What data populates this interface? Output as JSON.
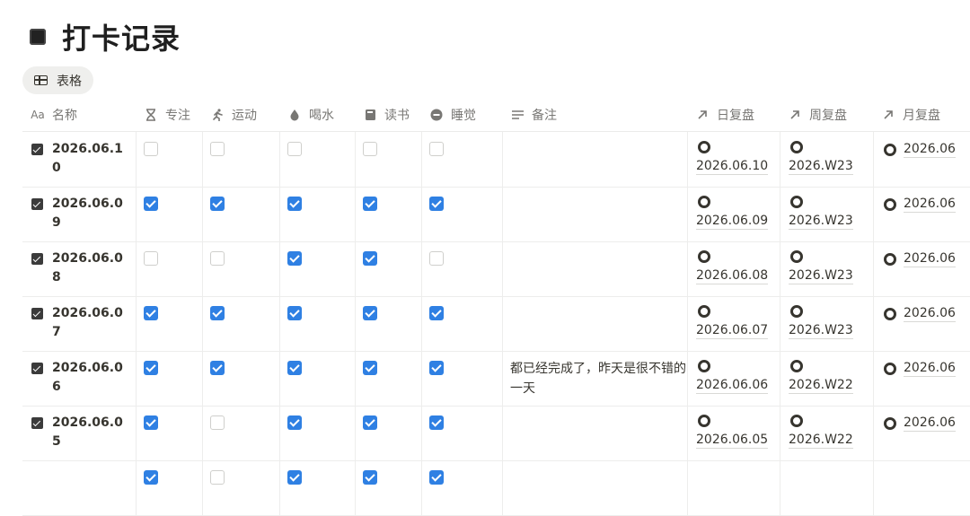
{
  "page": {
    "title": "打卡记录",
    "title_icon": "black-square-icon"
  },
  "view": {
    "label": "表格",
    "icon": "table-icon"
  },
  "columns": {
    "name": {
      "label": "名称",
      "icon": "Aa"
    },
    "focus": {
      "label": "专注",
      "icon": "hourglass-icon"
    },
    "exercise": {
      "label": "运动",
      "icon": "running-icon"
    },
    "water": {
      "label": "喝水",
      "icon": "water-drop-icon"
    },
    "reading": {
      "label": "读书",
      "icon": "book-icon"
    },
    "sleep": {
      "label": "睡觉",
      "icon": "minus-circle-icon"
    },
    "note": {
      "label": "备注",
      "icon": "text-lines-icon"
    },
    "day": {
      "label": "日复盘",
      "icon": "arrow-up-right-icon"
    },
    "week": {
      "label": "周复盘",
      "icon": "arrow-up-right-icon"
    },
    "month": {
      "label": "月复盘",
      "icon": "arrow-up-right-icon"
    }
  },
  "rows": [
    {
      "name": "2026.06.10",
      "done": true,
      "checks": [
        false,
        false,
        false,
        false,
        false
      ],
      "note": "",
      "day": "2026.06.10",
      "week": "2026.W23",
      "month": "2026.06"
    },
    {
      "name": "2026.06.09",
      "done": true,
      "checks": [
        true,
        true,
        true,
        true,
        true
      ],
      "note": "",
      "day": "2026.06.09",
      "week": "2026.W23",
      "month": "2026.06"
    },
    {
      "name": "2026.06.08",
      "done": true,
      "checks": [
        false,
        false,
        true,
        true,
        false
      ],
      "note": "",
      "day": "2026.06.08",
      "week": "2026.W23",
      "month": "2026.06"
    },
    {
      "name": "2026.06.07",
      "done": true,
      "checks": [
        true,
        true,
        true,
        true,
        true
      ],
      "note": "",
      "day": "2026.06.07",
      "week": "2026.W23",
      "month": "2026.06"
    },
    {
      "name": "2026.06.06",
      "done": true,
      "checks": [
        true,
        true,
        true,
        true,
        true
      ],
      "note": "都已经完成了，昨天是很不错的一天",
      "day": "2026.06.06",
      "week": "2026.W22",
      "month": "2026.06"
    },
    {
      "name": "2026.06.05",
      "done": true,
      "checks": [
        true,
        false,
        true,
        true,
        true
      ],
      "note": "",
      "day": "2026.06.05",
      "week": "2026.W22",
      "month": "2026.06"
    }
  ],
  "partial_row": {
    "checks": [
      true,
      false,
      true,
      true,
      true
    ]
  }
}
